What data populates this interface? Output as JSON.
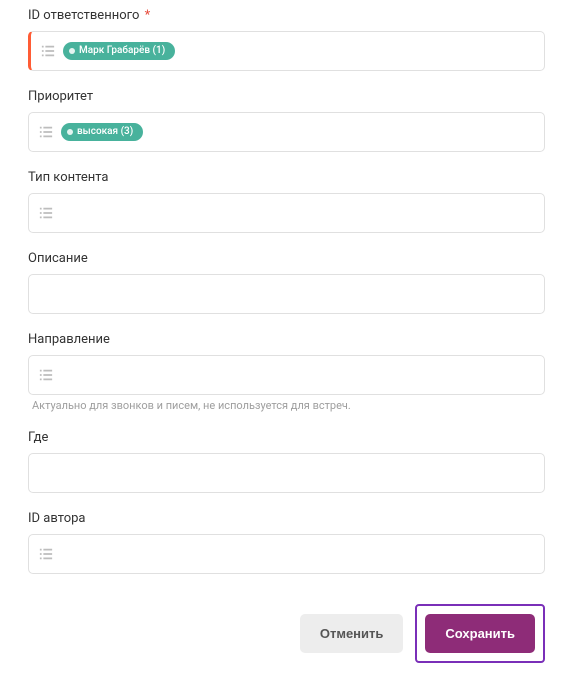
{
  "fields": {
    "responsible": {
      "label": "ID ответственного",
      "required_marker": "*",
      "tag": "Марк Грабарёв (1)"
    },
    "priority": {
      "label": "Приоритет",
      "tag": "высокая (3)"
    },
    "content_type": {
      "label": "Тип контента"
    },
    "description": {
      "label": "Описание"
    },
    "direction": {
      "label": "Направление",
      "help": "Актуально для звонков и писем, не используется для встреч."
    },
    "where": {
      "label": "Где"
    },
    "author": {
      "label": "ID автора"
    }
  },
  "buttons": {
    "cancel": "Отменить",
    "save": "Сохранить"
  }
}
